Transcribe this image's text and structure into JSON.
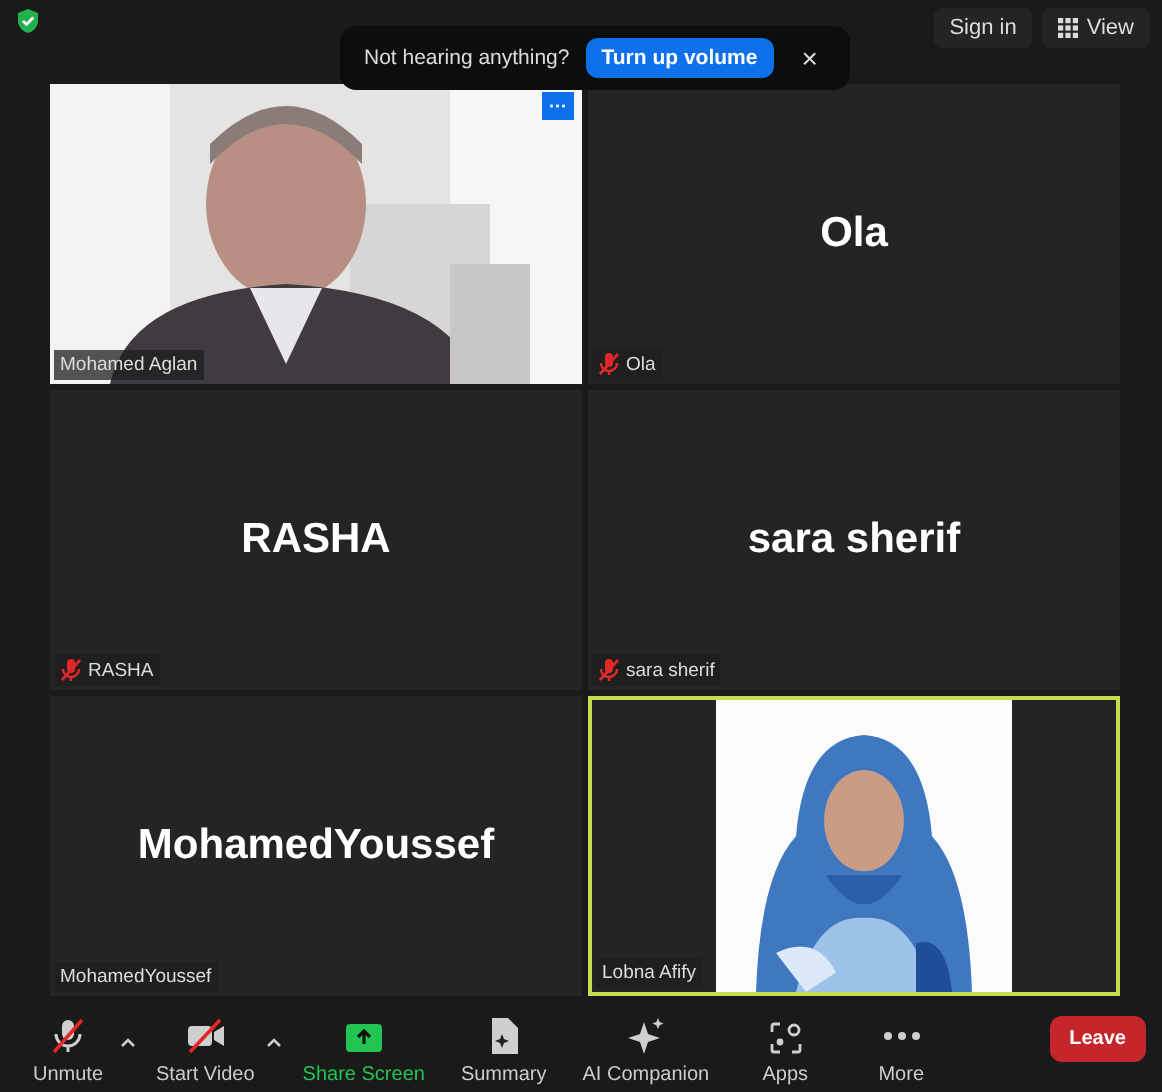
{
  "top_bar": {
    "sign_in": "Sign in",
    "view": "View"
  },
  "toast": {
    "message": "Not hearing anything?",
    "action": "Turn up volume",
    "close": "×"
  },
  "tiles": [
    {
      "kind": "video",
      "label": "Mohamed Aglan",
      "muted": false,
      "active_speaker": false,
      "more": "···"
    },
    {
      "kind": "name",
      "display_name": "Ola",
      "label": "Ola",
      "muted": true,
      "active_speaker": false
    },
    {
      "kind": "name",
      "display_name": "RASHA",
      "label": "RASHA",
      "muted": true,
      "active_speaker": false
    },
    {
      "kind": "name",
      "display_name": "sara sherif",
      "label": "sara sherif",
      "muted": true,
      "active_speaker": false
    },
    {
      "kind": "name",
      "display_name": "MohamedYoussef",
      "label": "MohamedYoussef",
      "muted": false,
      "active_speaker": false
    },
    {
      "kind": "portrait",
      "label": "Lobna Afify",
      "muted": false,
      "active_speaker": true
    }
  ],
  "toolbar": [
    {
      "kind": "mic",
      "label": "Unmute",
      "off": true,
      "has_menu": true
    },
    {
      "kind": "camera",
      "label": "Start Video",
      "off": true,
      "has_menu": true
    },
    {
      "kind": "share",
      "label": "Share Screen",
      "highlight": true
    },
    {
      "kind": "summary",
      "label": "Summary"
    },
    {
      "kind": "ai",
      "label": "AI Companion"
    },
    {
      "kind": "apps",
      "label": "Apps"
    },
    {
      "kind": "more",
      "label": "More"
    }
  ],
  "leave": "Leave"
}
